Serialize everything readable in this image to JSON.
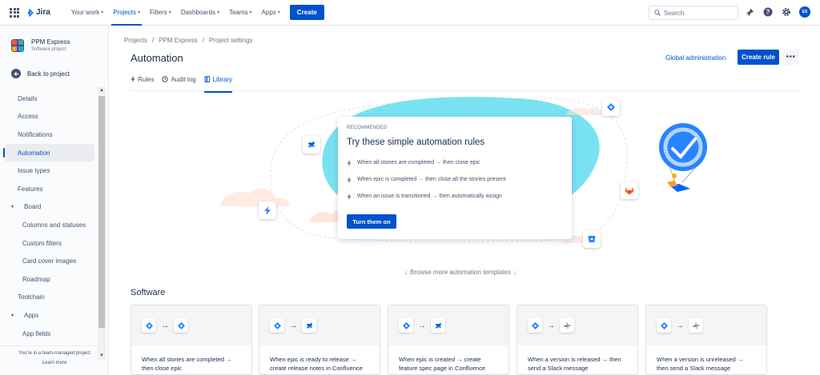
{
  "topnav": {
    "logo": "Jira",
    "items": [
      {
        "label": "Your work"
      },
      {
        "label": "Projects"
      },
      {
        "label": "Filters"
      },
      {
        "label": "Dashboards"
      },
      {
        "label": "Teams"
      },
      {
        "label": "Apps"
      }
    ],
    "create_label": "Create",
    "search_placeholder": "Search",
    "avatar_initials": "ES"
  },
  "sidebar": {
    "project_name": "PPM Express",
    "project_type": "Software project",
    "back_label": "Back to project",
    "items": [
      {
        "label": "Details"
      },
      {
        "label": "Access"
      },
      {
        "label": "Notifications"
      },
      {
        "label": "Automation"
      },
      {
        "label": "Issue types"
      },
      {
        "label": "Features"
      },
      {
        "label": "Board"
      },
      {
        "label": "Columns and statuses"
      },
      {
        "label": "Custom filters"
      },
      {
        "label": "Card cover images"
      },
      {
        "label": "Roadmap"
      },
      {
        "label": "Toolchain"
      },
      {
        "label": "Apps"
      },
      {
        "label": "App fields"
      }
    ],
    "footer_text": "You're in a team-managed project",
    "footer_link": "Learn more"
  },
  "breadcrumb": [
    "Projects",
    "/",
    "PPM Express",
    "/",
    "Project settings"
  ],
  "page": {
    "title": "Automation",
    "global_admin": "Global administration",
    "create_rule": "Create rule",
    "more": "•••"
  },
  "tabs": [
    {
      "label": "Rules"
    },
    {
      "label": "Audit log"
    },
    {
      "label": "Library"
    }
  ],
  "recommended": {
    "label": "RECOMMENDED",
    "title": "Try these simple automation rules",
    "items": [
      "When all stories are completed → then close epic",
      "When epic is completed → then close all the stories present",
      "When an issue is transitioned → then automatically assign"
    ],
    "button": "Turn them on"
  },
  "browse_label": "Browse more automation templates",
  "software": {
    "heading": "Software",
    "cards": [
      {
        "line1": "When all stories are completed →",
        "line2": "then close epic",
        "icons": [
          "jira-icon",
          "jira-icon"
        ]
      },
      {
        "line1": "When epic is ready to release →",
        "line2": "create release notes in Confluence",
        "icons": [
          "jira-icon",
          "confluence-icon"
        ]
      },
      {
        "line1": "When epic is created → create",
        "line2": "feature spec page in Confluence",
        "icons": [
          "jira-icon",
          "confluence-icon"
        ]
      },
      {
        "line1": "When a version is released → then",
        "line2": "send a Slack message",
        "icons": [
          "jira-icon",
          "slack-icon"
        ]
      },
      {
        "line1": "When a version is unreleased →",
        "line2": "then send a Slack message",
        "icons": [
          "jira-icon",
          "slack-icon"
        ]
      }
    ]
  },
  "colors": {
    "brand": "#0052cc",
    "blob": "#79e2f2",
    "text": "#172b4d"
  }
}
